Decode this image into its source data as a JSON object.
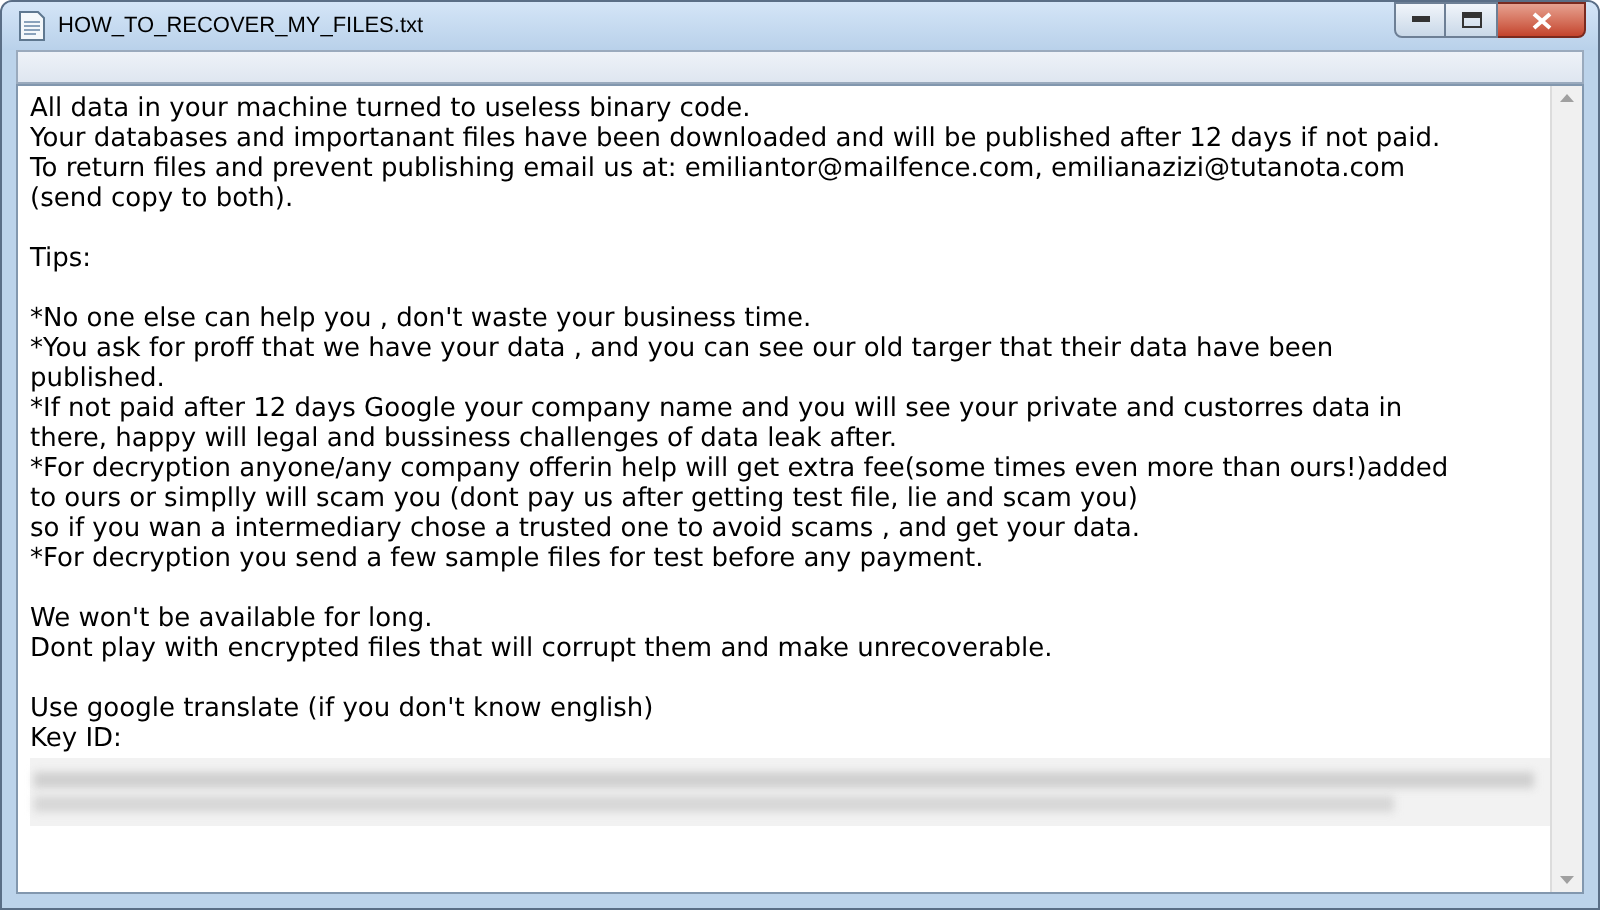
{
  "window": {
    "title": "HOW_TO_RECOVER_MY_FILES.txt"
  },
  "document": {
    "paragraphs": [
      [
        "All data in your machine turned to useless binary code.",
        "Your databases and importanant files have been downloaded and will be published after 12 days if not paid.",
        "To return files and prevent publishing email us at: emiliantor@mailfence.com, emilianazizi@tutanota.com",
        "(send copy to both)."
      ],
      [
        "Tips:"
      ],
      [
        "*No one else can help you , don't waste your business time.",
        "*You ask for proff that we have your data , and you can see our old targer that their data have been",
        "published.",
        "*If not paid after 12 days Google your company name and you will see your private and custorres data in",
        "there, happy will legal and bussiness challenges of data leak after.",
        "*For decryption anyone/any company offerin help will get extra fee(some times even more than ours!)added",
        "to ours or simplly will scam you (dont pay us after getting test file, lie and scam you)",
        "so if you wan a intermediary chose a trusted one to avoid scams , and get your data.",
        "*For decryption you send a few sample files for test before any payment."
      ],
      [
        "We won't be available for long.",
        "Dont play with encrypted files that will corrupt them and make unrecoverable."
      ],
      [
        "Use google translate (if you don't know english)",
        "Key ID:"
      ]
    ]
  }
}
